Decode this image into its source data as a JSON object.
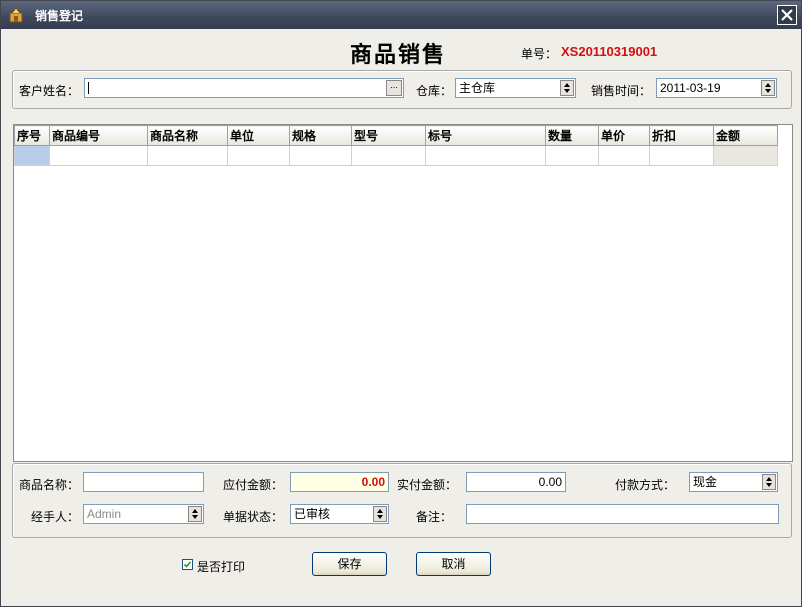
{
  "window": {
    "title": "销售登记",
    "icon": "app-icon"
  },
  "header": {
    "title": "商品销售",
    "order_label": "单号：",
    "order_no": "XS20110319001"
  },
  "top_form": {
    "customer_label": "客户姓名：",
    "customer_value": "",
    "customer_button": "...",
    "warehouse_label": "仓库：",
    "warehouse_value": "主仓库",
    "sale_time_label": "销售时间：",
    "sale_time_value": "2011-03-19"
  },
  "grid": {
    "columns": [
      "序号",
      "商品编号",
      "商品名称",
      "单位",
      "规格",
      "型号",
      "标号",
      "数量",
      "单价",
      "折扣",
      "金额"
    ],
    "rows": [
      [
        "",
        "",
        "",
        "",
        "",
        "",
        "",
        "",
        "",
        "",
        ""
      ]
    ]
  },
  "bottom_form": {
    "product_name_label": "商品名称：",
    "product_name_value": "",
    "payable_label": "应付金额：",
    "payable_value": "0.00",
    "paid_label": "实付金额：",
    "paid_value": "0.00",
    "payment_method_label": "付款方式：",
    "payment_method_value": "现金",
    "handler_label": "经手人：",
    "handler_value": "Admin",
    "doc_status_label": "单据状态：",
    "doc_status_value": "已审核",
    "remark_label": "备注：",
    "remark_value": ""
  },
  "footer": {
    "print_label": "是否打印",
    "print_checked": true,
    "save_label": "保存",
    "cancel_label": "取消"
  },
  "colors": {
    "order_no": "#d01010",
    "payable_value": "#d01010",
    "payable_bg": "#ffffe6",
    "titlebar": "#3e485c"
  }
}
